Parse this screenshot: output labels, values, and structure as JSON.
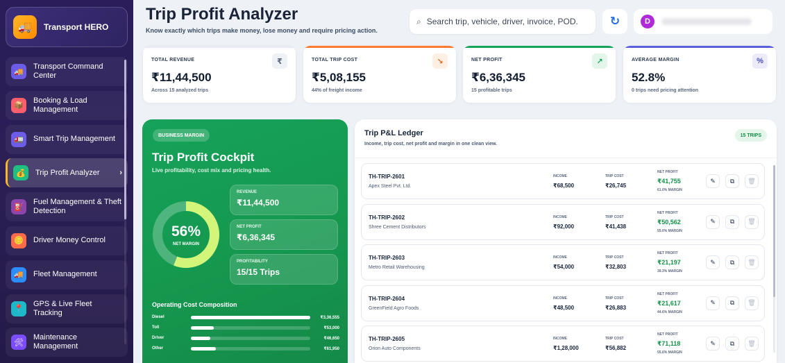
{
  "colors": {
    "sidebar_bg": "#2a1d5a",
    "accent_green": "#16a25a",
    "accent_gold": "#ffb627",
    "profit_green": "#149247"
  },
  "sidebar": {
    "brand": "Transport HERO",
    "brand_icon": "truck-icon",
    "items": [
      {
        "label": "Transport Command Center",
        "icon": "truck-icon",
        "color": "#6c5ce7"
      },
      {
        "label": "Booking & Load Management",
        "icon": "box-icon",
        "color": "#ff5f6d"
      },
      {
        "label": "Smart Trip Management",
        "icon": "route-icon",
        "color": "#6c5ce7"
      },
      {
        "label": "Trip Profit Analyzer",
        "icon": "money-bag-icon",
        "color": "#1fbf84",
        "active": true
      },
      {
        "label": "Fuel Management & Theft Detection",
        "icon": "fuel-icon",
        "color": "#8e44ad"
      },
      {
        "label": "Driver Money Control",
        "icon": "coins-icon",
        "color": "#ff6b4a"
      },
      {
        "label": "Fleet Management",
        "icon": "fleet-icon",
        "color": "#2d8cff"
      },
      {
        "label": "GPS & Live Fleet Tracking",
        "icon": "pin-icon",
        "color": "#1fb8c9"
      },
      {
        "label": "Maintenance Management",
        "icon": "wrench-icon",
        "color": "#7c4dff"
      }
    ]
  },
  "header": {
    "title": "Trip Profit Analyzer",
    "subtitle": "Know exactly which trips make money, lose money and require pricing action.",
    "search_placeholder": "Search trip, vehicle, driver, invoice, POD.",
    "avatar_initial": "D"
  },
  "kpis": [
    {
      "label": "TOTAL REVENUE",
      "value": "₹11,44,500",
      "note": "Across 15 analyzed trips",
      "icon": "rupee-icon",
      "glyph": "₹",
      "bar": "#e8ecf2",
      "icon_bg": "#eef1f5",
      "icon_color": "#5c6880"
    },
    {
      "label": "TOTAL TRIP COST",
      "value": "₹5,08,155",
      "note": "44% of freight income",
      "icon": "trend-down-icon",
      "glyph": "↘",
      "bar": "#ff7a2f",
      "icon_bg": "#ffeee2",
      "icon_color": "#e8692a"
    },
    {
      "label": "NET PROFIT",
      "value": "₹6,36,345",
      "note": "15 profitable trips",
      "icon": "trend-up-icon",
      "glyph": "↗",
      "bar": "#17a35a",
      "icon_bg": "#e4f6ea",
      "icon_color": "#17a35a"
    },
    {
      "label": "AVERAGE MARGIN",
      "value": "52.8%",
      "note": "0 trips need pricing attention",
      "icon": "percent-icon",
      "glyph": "%",
      "bar": "#5a5fe0",
      "icon_bg": "#ecebfb",
      "icon_color": "#4a4fc9"
    }
  ],
  "cockpit": {
    "badge": "BUSINESS MARGIN",
    "title": "Trip Profit Cockpit",
    "subtitle": "Live profitability, cost mix and pricing health.",
    "margin_pct": 56,
    "margin_text": "56%",
    "margin_label": "NET MARGIN",
    "metrics": [
      {
        "label": "REVENUE",
        "value": "₹11,44,500"
      },
      {
        "label": "NET PROFIT",
        "value": "₹6,36,345"
      },
      {
        "label": "PROFITABILITY",
        "value": "15/15 Trips"
      }
    ],
    "cost_title": "Operating Cost Composition",
    "costs": [
      {
        "name": "Diesel",
        "value": "₹3,36,555",
        "pct": 100
      },
      {
        "name": "Toll",
        "value": "₹53,000",
        "pct": 19
      },
      {
        "name": "Driver",
        "value": "₹46,650",
        "pct": 16
      },
      {
        "name": "Other",
        "value": "₹61,950",
        "pct": 21
      }
    ]
  },
  "ledger": {
    "title": "Trip P&L Ledger",
    "subtitle": "Income, trip cost, net profit and margin in one clean view.",
    "badge": "15 TRIPS",
    "col_income": "INCOME",
    "col_cost": "TRIP COST",
    "col_profit": "NET PROFIT",
    "rows": [
      {
        "id": "TH-TRIP-2601",
        "client": "Apex Steel Pvt. Ltd.",
        "income": "₹68,500",
        "cost": "₹26,745",
        "profit": "₹41,755",
        "margin": "61.0% MARGIN"
      },
      {
        "id": "TH-TRIP-2602",
        "client": "Shree Cement Distributors",
        "income": "₹92,000",
        "cost": "₹41,438",
        "profit": "₹50,562",
        "margin": "55.0% MARGIN"
      },
      {
        "id": "TH-TRIP-2603",
        "client": "Metro Retail Warehousing",
        "income": "₹54,000",
        "cost": "₹32,803",
        "profit": "₹21,197",
        "margin": "39.3% MARGIN"
      },
      {
        "id": "TH-TRIP-2604",
        "client": "GreenField Agro Foods",
        "income": "₹48,500",
        "cost": "₹26,883",
        "profit": "₹21,617",
        "margin": "44.6% MARGIN"
      },
      {
        "id": "TH-TRIP-2605",
        "client": "Orion Auto Components",
        "income": "₹1,28,000",
        "cost": "₹56,882",
        "profit": "₹71,118",
        "margin": "55.6% MARGIN"
      }
    ]
  }
}
